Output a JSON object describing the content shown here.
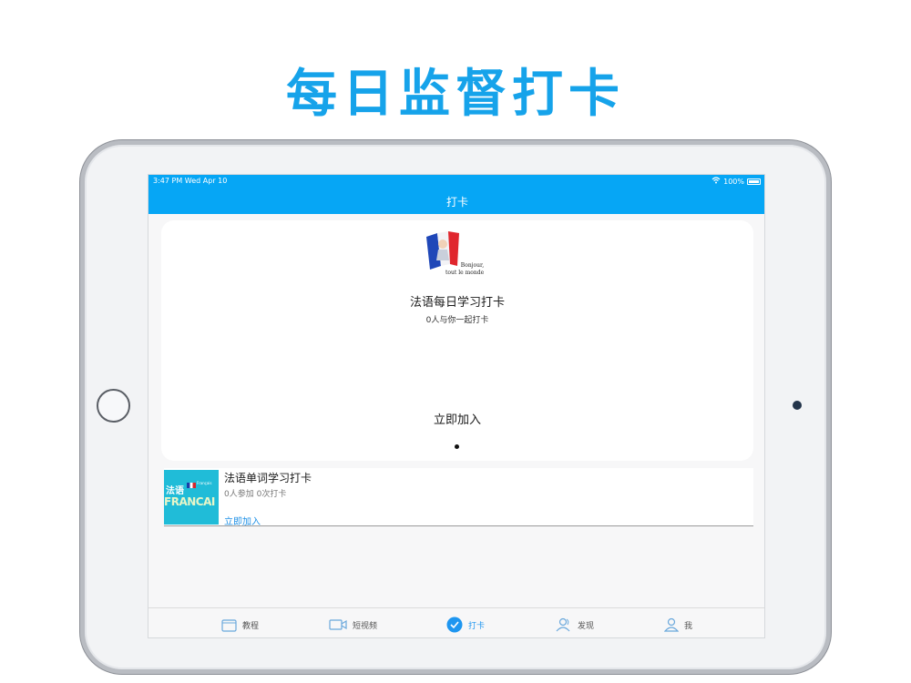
{
  "headline": "每日监督打卡",
  "status_bar": {
    "time": "3:47 PM   Wed Apr 10",
    "battery": "100%"
  },
  "nav": {
    "title": "打卡"
  },
  "featured": {
    "image_caption_line1": "Bonjour,",
    "image_caption_line2": "tout le monde",
    "title": "法语每日学习打卡",
    "subtitle": "0人与你一起打卡",
    "join_label": "立即加入"
  },
  "list": [
    {
      "thumb_text1": "法语",
      "thumb_text2": "FRANCAI",
      "thumb_small": "Français",
      "title": "法语单词学习打卡",
      "meta": "0人参加 0次打卡",
      "join_label": "立即加入"
    }
  ],
  "tabs": [
    {
      "label": "教程",
      "icon": "folder-icon"
    },
    {
      "label": "短视频",
      "icon": "video-camera-icon"
    },
    {
      "label": "打卡",
      "icon": "check-circle-icon",
      "active": true
    },
    {
      "label": "发现",
      "icon": "people-icon"
    },
    {
      "label": "我",
      "icon": "person-icon"
    }
  ],
  "colors": {
    "accent": "#06a6f5",
    "headline": "#16a3ea",
    "link": "#1e90e6"
  }
}
